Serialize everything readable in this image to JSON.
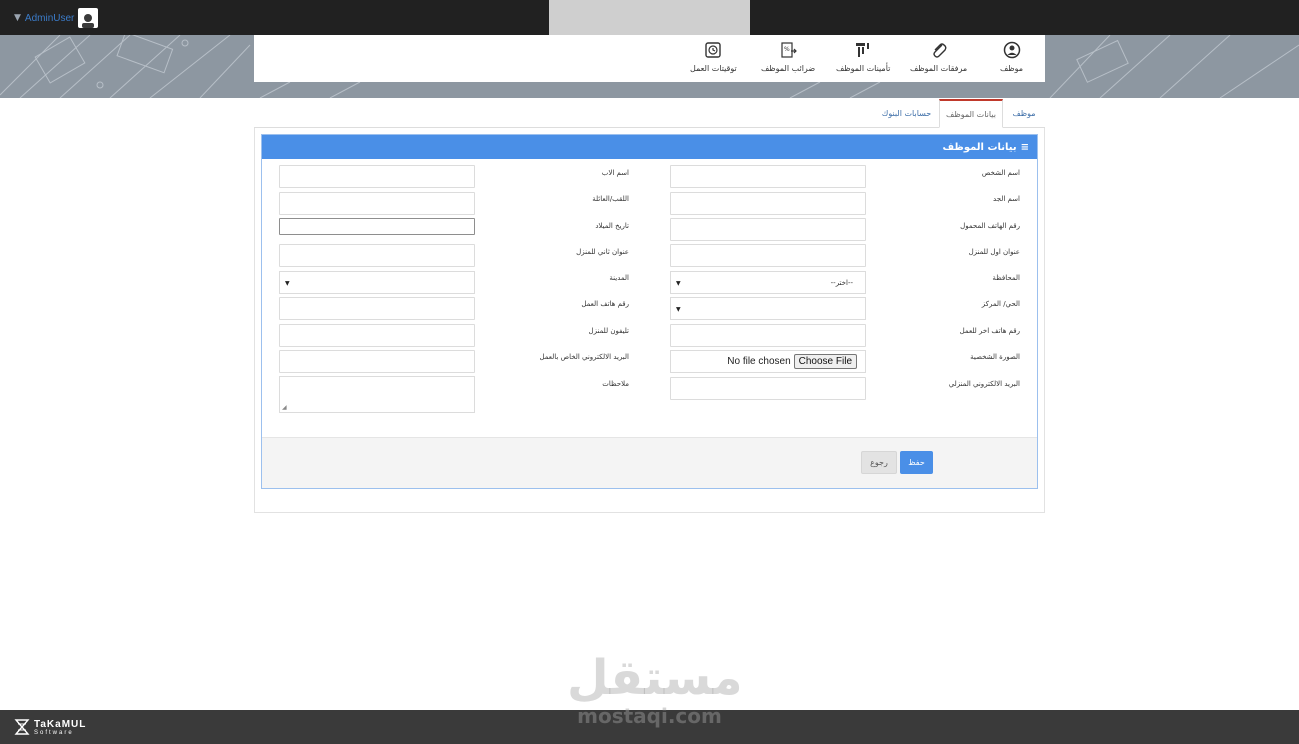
{
  "topbar": {
    "username": "AdminUser"
  },
  "toolbar": {
    "items": [
      {
        "label": "موظف",
        "icon": "user-circle-icon"
      },
      {
        "label": "مرفقات الموظف",
        "icon": "paperclip-icon"
      },
      {
        "label": "تأمينات الموظف",
        "icon": "insurance-icon"
      },
      {
        "label": "ضرائب الموظف",
        "icon": "tax-icon"
      },
      {
        "label": "توقيتات العمل",
        "icon": "clock-icon"
      }
    ]
  },
  "tabs": [
    {
      "label": "موظف"
    },
    {
      "label": "بيانات الموظف"
    },
    {
      "label": "حسابات البنوك"
    }
  ],
  "panel": {
    "title": "بيانات الموظف",
    "icon": "menu-lines-icon"
  },
  "form": {
    "right": [
      {
        "label": "اسم الشخص",
        "value": ""
      },
      {
        "label": "اسم الجد",
        "value": ""
      },
      {
        "label": "رقم الهاتف المحمول",
        "value": ""
      },
      {
        "label": "عنوان اول للمنزل",
        "value": ""
      },
      {
        "label": "المحافظة",
        "value": "--اختر--"
      },
      {
        "label": "الحي/ المركز",
        "value": ""
      },
      {
        "label": "رقم هاتف اخر للعمل",
        "value": ""
      },
      {
        "label": "الصورة الشخصية",
        "value": ""
      },
      {
        "label": "البريد الالكتروني المنزلي",
        "value": ""
      }
    ],
    "left": [
      {
        "label": "اسم الاب",
        "value": ""
      },
      {
        "label": "اللقب/العائلة",
        "value": ""
      },
      {
        "label": "تاريخ الميلاد",
        "value": ""
      },
      {
        "label": "عنوان ثاني للمنزل",
        "value": ""
      },
      {
        "label": "المدينة",
        "value": ""
      },
      {
        "label": "رقم هاتف العمل",
        "value": ""
      },
      {
        "label": "تليفون للمنزل",
        "value": ""
      },
      {
        "label": "البريد الالكتروني الخاص بالعمل",
        "value": ""
      },
      {
        "label": "ملاحظات",
        "value": ""
      }
    ],
    "file": {
      "status": "No file chosen",
      "button": "Choose File"
    }
  },
  "actions": {
    "save": "حفظ",
    "back": "رجوع"
  },
  "footer": {
    "brand": "TaKaMUL",
    "sub": "Software"
  },
  "watermark": {
    "arabic": "مستقل",
    "url": "mostaqi.com"
  },
  "colors": {
    "accent": "#4a8fe7",
    "topbar": "#212121",
    "footer": "#3a3a3a",
    "active_tab": "#c0392b"
  }
}
